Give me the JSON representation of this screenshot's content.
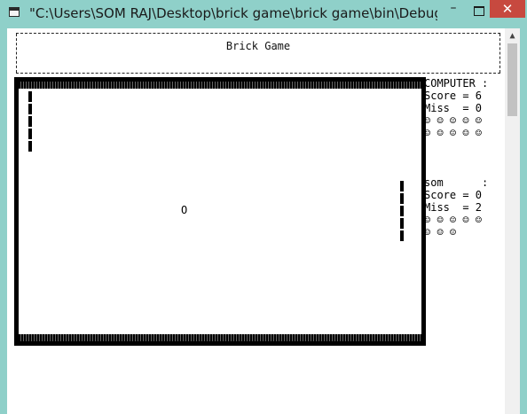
{
  "window": {
    "title": "\"C:\\Users\\SOM RAJ\\Desktop\\brick game\\brick game\\bin\\Debug\\br...",
    "minimize": "–",
    "close": "✕"
  },
  "banner": {
    "title": "Brick Game"
  },
  "ball": "O",
  "computer": {
    "name_line": "COMPUTER :",
    "score_line": "Score = 6",
    "miss_line": "Miss  = 0",
    "lives_row1": "☺ ☺ ☺ ☺ ☺",
    "lives_row2": "☺ ☺ ☺ ☺ ☺"
  },
  "player": {
    "name_line": "som      :",
    "score_line": "Score = 0",
    "miss_line": "Miss  = 2",
    "lives_row1": "☺ ☺ ☺ ☺ ☺",
    "lives_row2": "☺ ☺ ☺"
  },
  "icons": {
    "app": "console-app-icon",
    "scroll_up": "▲"
  }
}
